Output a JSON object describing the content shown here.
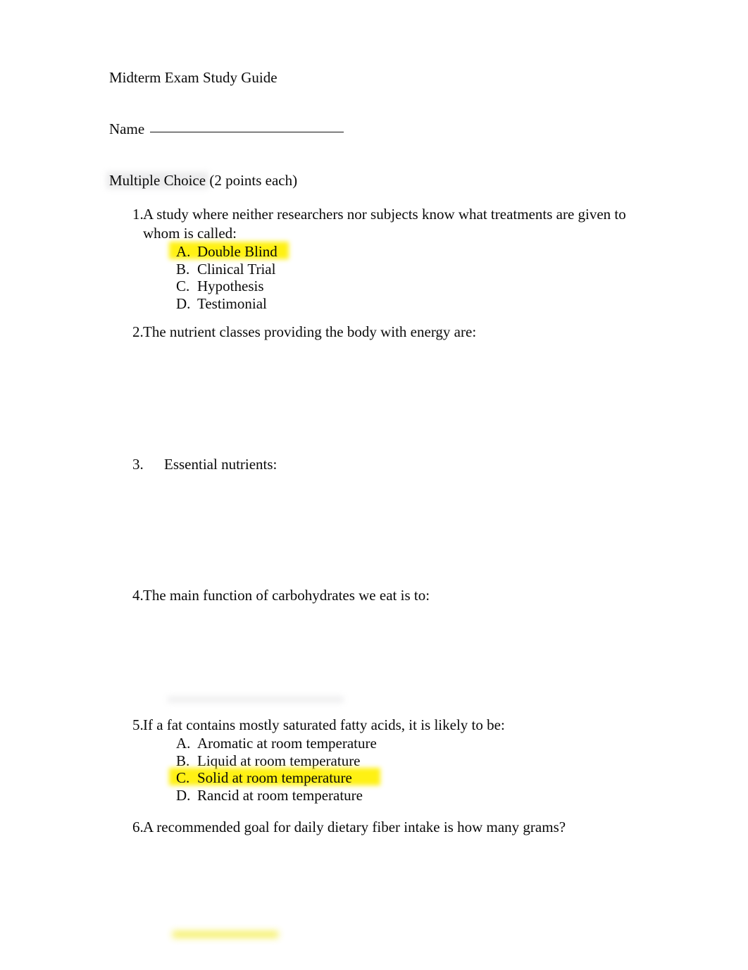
{
  "document": {
    "title": "Midterm Exam Study Guide",
    "name_label": "Name",
    "name_value": "",
    "section_heading": "Multiple Choice",
    "section_points": "(2 points each)",
    "highlight_color": "#FFF000",
    "questions": [
      {
        "number": "1.",
        "text": "A study where neither researchers nor subjects know what treatments are given to whom is called:",
        "options": [
          {
            "letter": "A.",
            "text": "Double Blind",
            "highlighted": true
          },
          {
            "letter": "B.",
            "text": "Clinical Trial",
            "highlighted": false
          },
          {
            "letter": "C.",
            "text": "Hypothesis",
            "highlighted": false
          },
          {
            "letter": "D.",
            "text": "Testimonial",
            "highlighted": false
          }
        ]
      },
      {
        "number": "2.",
        "text": "The nutrient classes providing the body with energy are:",
        "options": []
      },
      {
        "number": "3.",
        "text": "Essential nutrients:",
        "options": []
      },
      {
        "number": "4.",
        "text": "The main function of carbohydrates we eat is to:",
        "options": []
      },
      {
        "number": "5.",
        "text": "If a fat contains mostly saturated fatty acids, it is likely to be:",
        "options": [
          {
            "letter": "A.",
            "text": "Aromatic at room temperature",
            "highlighted": false
          },
          {
            "letter": "B.",
            "text": "Liquid at room temperature",
            "highlighted": false
          },
          {
            "letter": "C.",
            "text": "Solid at room temperature",
            "highlighted": true
          },
          {
            "letter": "D.",
            "text": "Rancid at room temperature",
            "highlighted": false
          }
        ]
      },
      {
        "number": "6.",
        "text": "A recommended goal for daily dietary fiber intake is how many grams?",
        "options": []
      }
    ]
  }
}
